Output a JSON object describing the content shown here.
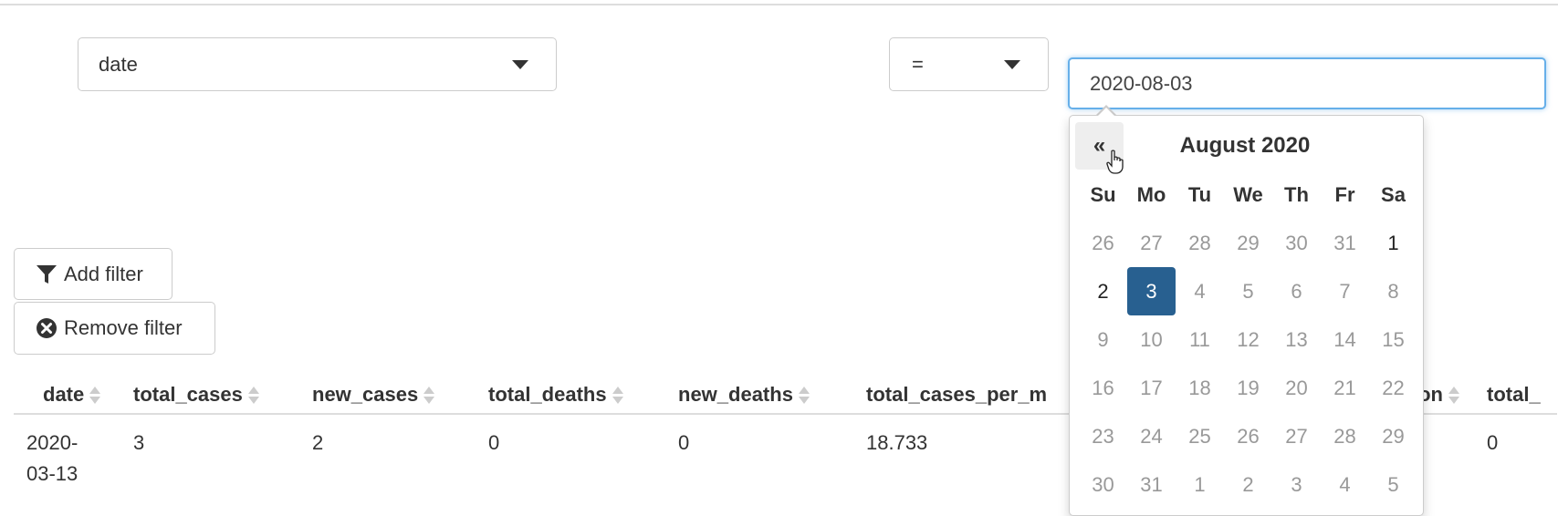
{
  "filter": {
    "field_select": {
      "value": "date"
    },
    "operator_select": {
      "value": "="
    },
    "date_input": {
      "value": "2020-08-03"
    }
  },
  "buttons": {
    "add_filter": "Add filter",
    "remove_filter": "Remove filter"
  },
  "datepicker": {
    "prev_label": "«",
    "title": "August 2020",
    "weekdays": [
      "Su",
      "Mo",
      "Tu",
      "We",
      "Th",
      "Fr",
      "Sa"
    ],
    "days": [
      [
        "26",
        "27",
        "28",
        "29",
        "30",
        "31",
        "1"
      ],
      [
        "2",
        "3",
        "4",
        "5",
        "6",
        "7",
        "8"
      ],
      [
        "9",
        "10",
        "11",
        "12",
        "13",
        "14",
        "15"
      ],
      [
        "16",
        "17",
        "18",
        "19",
        "20",
        "21",
        "22"
      ],
      [
        "23",
        "24",
        "25",
        "26",
        "27",
        "28",
        "29"
      ],
      [
        "30",
        "31",
        "1",
        "2",
        "3",
        "4",
        "5"
      ]
    ],
    "selected": "3",
    "colors": {
      "selected_bg": "#286090",
      "prev_bg": "#eeeeee"
    }
  },
  "table": {
    "columns": [
      "date",
      "total_cases",
      "new_cases",
      "total_deaths",
      "new_deaths",
      "total_cases_per_m",
      "",
      "on",
      "total_"
    ],
    "rows": [
      [
        "2020-\n03-13",
        "3",
        "2",
        "0",
        "0",
        "18.733",
        "",
        "",
        "0"
      ]
    ]
  }
}
